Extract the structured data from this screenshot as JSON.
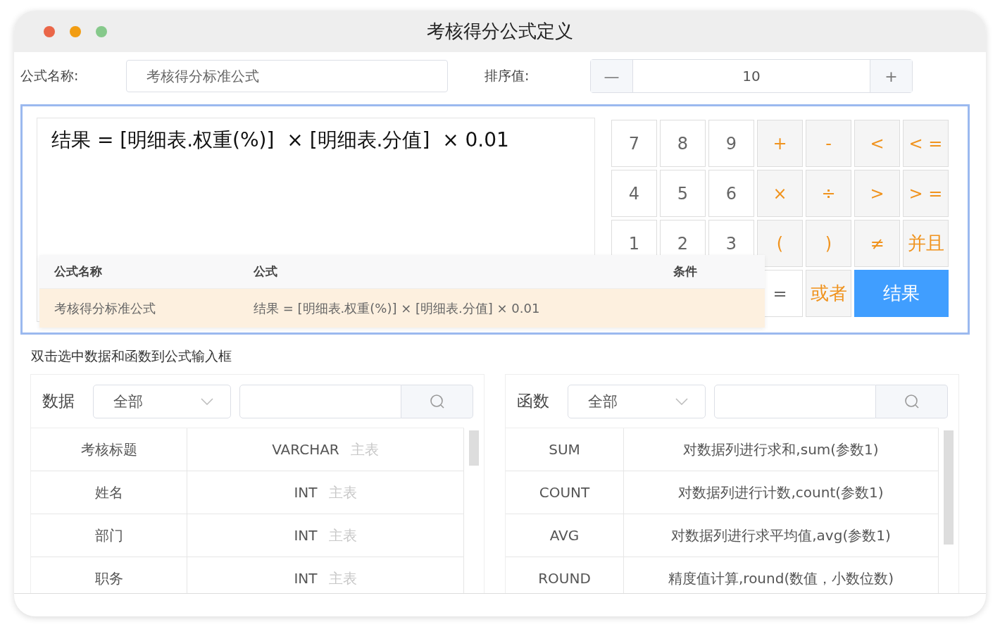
{
  "window": {
    "title": "考核得分公式定义"
  },
  "form": {
    "name_label": "公式名称:",
    "name_value": "考核得分标准公式",
    "order_label": "排序值:",
    "order_value": "10",
    "minus": "—",
    "plus": "+"
  },
  "editor": {
    "value": "结果 = [明细表.权重(%)]  × [明细表.分值]  × 0.01"
  },
  "keypad": {
    "rows": [
      [
        {
          "label": "7",
          "kind": "digit"
        },
        {
          "label": "8",
          "kind": "digit"
        },
        {
          "label": "9",
          "kind": "digit"
        },
        {
          "label": "+",
          "kind": "operator"
        },
        {
          "label": "-",
          "kind": "operator"
        },
        {
          "label": "<",
          "kind": "operator"
        },
        {
          "label": "< =",
          "kind": "operator"
        }
      ],
      [
        {
          "label": "4",
          "kind": "digit"
        },
        {
          "label": "5",
          "kind": "digit"
        },
        {
          "label": "6",
          "kind": "digit"
        },
        {
          "label": "×",
          "kind": "operator"
        },
        {
          "label": "÷",
          "kind": "operator"
        },
        {
          "label": ">",
          "kind": "operator"
        },
        {
          "label": "> =",
          "kind": "operator"
        }
      ],
      [
        {
          "label": "1",
          "kind": "digit"
        },
        {
          "label": "2",
          "kind": "digit"
        },
        {
          "label": "3",
          "kind": "digit"
        },
        {
          "label": "(",
          "kind": "operator"
        },
        {
          "label": ")",
          "kind": "operator"
        },
        {
          "label": "≠",
          "kind": "operator"
        },
        {
          "label": "并且",
          "kind": "logic"
        }
      ],
      [
        {
          "kind": "covered"
        },
        {
          "kind": "covered"
        },
        {
          "kind": "covered"
        },
        {
          "label": "=",
          "kind": "digit"
        },
        {
          "label": "或者",
          "kind": "logic"
        },
        {
          "label": "结果",
          "kind": "result"
        }
      ]
    ]
  },
  "popup": {
    "columns": [
      "公式名称",
      "公式",
      "条件"
    ],
    "rows": [
      {
        "name": "考核得分标准公式",
        "formula": "结果 = [明细表.权重(%)] × [明细表.分值] × 0.01",
        "selected": true
      }
    ]
  },
  "hint": "双击选中数据和函数到公式输入框",
  "panels": [
    {
      "title": "数据",
      "filter": "全部",
      "rows": [
        {
          "column_1": "考核标题",
          "type": "VARCHAR",
          "source": "主表"
        },
        {
          "column_1": "姓名",
          "type": "INT",
          "source": "主表"
        },
        {
          "column_1": "部门",
          "type": "INT",
          "source": "主表"
        },
        {
          "column_1": "职务",
          "type": "INT",
          "source": "主表"
        }
      ]
    },
    {
      "title": "函数",
      "filter": "全部",
      "rows": [
        {
          "column_1": "SUM",
          "type": "对数据列进行求和,sum(参数1)"
        },
        {
          "column_1": "COUNT",
          "type": "对数据列进行计数,count(参数1)"
        },
        {
          "column_1": "AVG",
          "type": "对数据列进行求平均值,avg(参数1)"
        },
        {
          "column_1": "ROUND",
          "type": "精度值计算,round(数值，小数位数)"
        }
      ]
    }
  ]
}
